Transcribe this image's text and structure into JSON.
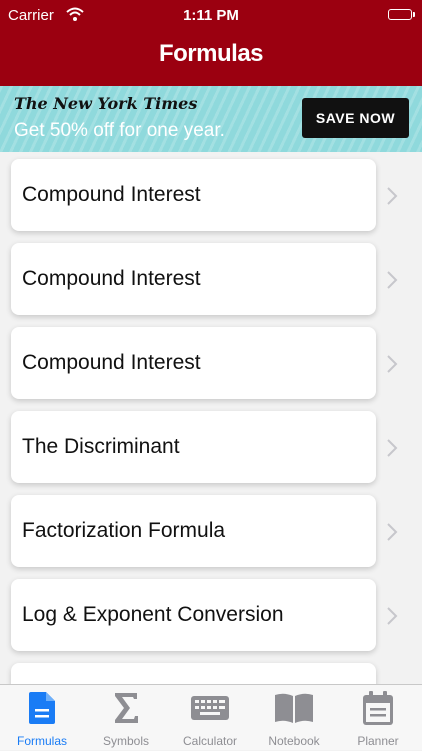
{
  "status_bar": {
    "carrier": "Carrier",
    "time": "1:11 PM"
  },
  "nav": {
    "title": "Formulas"
  },
  "ad": {
    "brand": "The New York Times",
    "offer": "Get 50% off for one year.",
    "button": "SAVE NOW"
  },
  "formulas": [
    "Compound Interest",
    "Compound Interest",
    "Compound Interest",
    "The Discriminant",
    "Factorization Formula",
    "Log & Exponent Conversion",
    ""
  ],
  "tabs": [
    {
      "label": "Formulas",
      "icon": "document-icon",
      "active": true
    },
    {
      "label": "Symbols",
      "icon": "sigma-icon",
      "active": false
    },
    {
      "label": "Calculator",
      "icon": "keyboard-icon",
      "active": false
    },
    {
      "label": "Notebook",
      "icon": "book-icon",
      "active": false
    },
    {
      "label": "Planner",
      "icon": "calendar-icon",
      "active": false
    }
  ],
  "colors": {
    "header": "#9b0010",
    "tab_active": "#1a7cf5",
    "tab_inactive": "#8e8e93",
    "ad_bg": "#8fd9dc"
  }
}
